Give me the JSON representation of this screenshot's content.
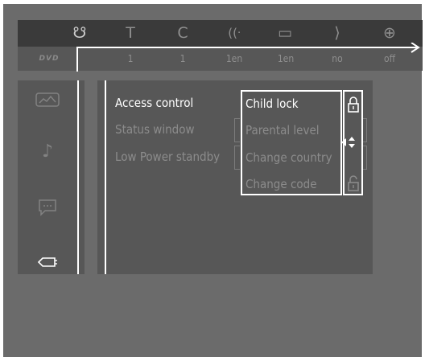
{
  "top_bar": {
    "icons": [
      {
        "name": "title-icon",
        "glyph": "☋"
      },
      {
        "name": "text-icon",
        "glyph": "T"
      },
      {
        "name": "chapter-icon",
        "glyph": "C"
      },
      {
        "name": "audio-icon",
        "glyph": "((ᐧ"
      },
      {
        "name": "subtitle-icon",
        "glyph": "▭"
      },
      {
        "name": "angle-icon",
        "glyph": "⟩"
      },
      {
        "name": "zoom-icon",
        "glyph": "⊕"
      }
    ],
    "values": [
      "1",
      "1",
      "1en",
      "1en",
      "no",
      "off"
    ],
    "dvd_logo": "DVD"
  },
  "sidebar": {
    "items": [
      {
        "name": "picture-settings-icon",
        "glyph": "⛰"
      },
      {
        "name": "sound-settings-icon",
        "glyph": "♪"
      },
      {
        "name": "language-settings-icon",
        "glyph": "💬"
      },
      {
        "name": "features-settings-icon",
        "glyph": "⇦"
      }
    ]
  },
  "menu": {
    "items": [
      {
        "label": "Access control",
        "active": true
      },
      {
        "label": "Status window",
        "active": false
      },
      {
        "label": "Low Power standby",
        "active": false
      }
    ]
  },
  "submenu": {
    "items": [
      {
        "label": "Child lock",
        "active": true
      },
      {
        "label": "Parental level",
        "active": false
      },
      {
        "label": "Change country",
        "active": false
      },
      {
        "label": "Change code",
        "active": false
      }
    ],
    "lock_icons": [
      "lock-closed-icon",
      "lock-open-icon"
    ],
    "nav_glyph": "◀▴▾"
  },
  "colors": {
    "background": "#6b6b6b",
    "bar_dark": "#3a3a3a",
    "panel": "#575757",
    "active_text": "#ffffff",
    "inactive_text": "#8c8c8c"
  }
}
